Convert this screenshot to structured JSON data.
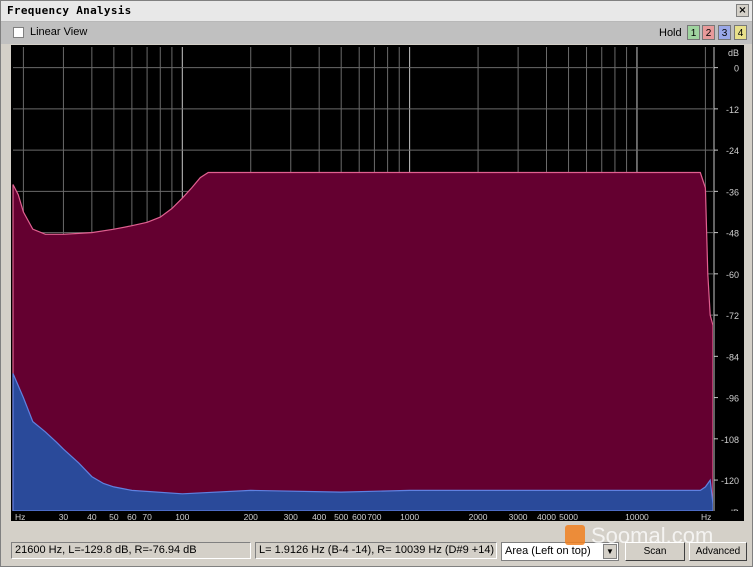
{
  "window": {
    "title": "Frequency Analysis",
    "close_label": "×"
  },
  "toolbar": {
    "linear_view_label": "Linear View",
    "hold_label": "Hold",
    "hold_buttons": [
      {
        "label": "1",
        "color": "#9fd49f"
      },
      {
        "label": "2",
        "color": "#e89a9a"
      },
      {
        "label": "3",
        "color": "#9aa8e8"
      },
      {
        "label": "4",
        "color": "#e8e08a"
      }
    ]
  },
  "chart_data": {
    "type": "area",
    "xscale": "log",
    "xlabel": "Hz",
    "ylabel": "dB",
    "xlim": [
      18,
      21600
    ],
    "ylim": [
      -129,
      6
    ],
    "x_ticks": [
      30,
      40,
      50,
      60,
      70,
      100,
      200,
      300,
      400,
      500,
      600,
      700,
      1000,
      2000,
      3000,
      4000,
      5000,
      10000
    ],
    "x_tick_labels": [
      "30",
      "40",
      "50",
      "60",
      "70",
      "100",
      "200",
      "300",
      "400",
      "500",
      "600",
      "700",
      "1000",
      "2000",
      "3000",
      "4000",
      "5000",
      "10000"
    ],
    "x_axis_start_label": "Hz",
    "x_axis_end_label": "Hz",
    "y_ticks": [
      0,
      -12,
      -24,
      -36,
      -48,
      -60,
      -72,
      -84,
      -96,
      -108,
      -120
    ],
    "y_tick_labels": [
      "0",
      "-12",
      "-24",
      "-36",
      "-48",
      "-60",
      "-72",
      "-84",
      "-96",
      "-108",
      "-120"
    ],
    "y_axis_top_label": "dB",
    "y_axis_bottom_label": "dB",
    "grid": true,
    "series": [
      {
        "channel": "left",
        "fill": "#640030",
        "stroke": "#e06090",
        "x": [
          18,
          19,
          20,
          22,
          25,
          30,
          40,
          50,
          60,
          70,
          80,
          90,
          100,
          110,
          120,
          130,
          200,
          500,
          1000,
          5000,
          10000,
          19000,
          20000,
          20500,
          21000,
          21600
        ],
        "y": [
          -34,
          -37,
          -42,
          -47,
          -48.5,
          -48.5,
          -48,
          -47,
          -46,
          -45,
          -43.5,
          -41,
          -38,
          -35,
          -32,
          -30.5,
          -30.5,
          -30.5,
          -30.5,
          -30.5,
          -30.5,
          -30.5,
          -35,
          -60,
          -72,
          -75
        ]
      },
      {
        "channel": "right",
        "fill": "#2a4a9a",
        "stroke": "#6080e0",
        "x": [
          18,
          20,
          22,
          25,
          28,
          30,
          35,
          40,
          45,
          50,
          60,
          100,
          200,
          500,
          1000,
          5000,
          10000,
          19000,
          20000,
          21000,
          21600
        ],
        "y": [
          -89,
          -96,
          -103,
          -106,
          -109,
          -111,
          -115,
          -119,
          -121,
          -122,
          -123,
          -124,
          -123,
          -123.5,
          -123,
          -123,
          -123,
          -123,
          -122,
          -120,
          -127
        ]
      }
    ]
  },
  "status": {
    "cursor_readout": "21600 Hz, L=-129.8 dB, R=-76.94 dB",
    "peak_readout": "L= 1.9126 Hz (B-4 -14), R=  10039 Hz (D#9 +14)",
    "view_mode_value": "Area (Left on top)",
    "scan_label": "Scan",
    "advanced_label": "Advanced"
  },
  "watermark_text": "Soomal.com"
}
